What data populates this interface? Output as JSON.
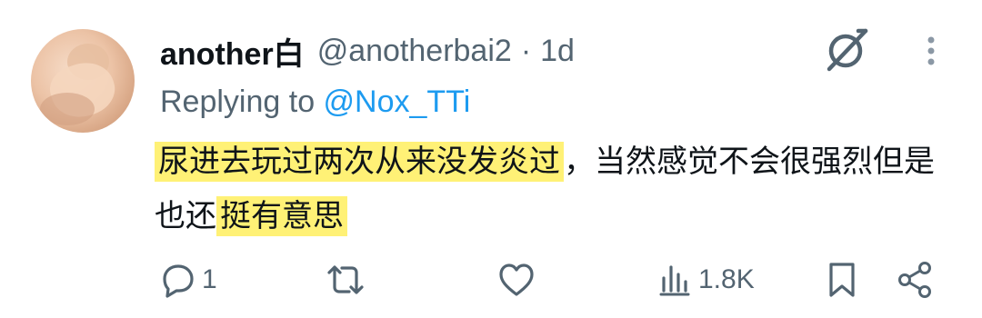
{
  "tweet": {
    "display_name": "another白",
    "handle": "@anotherbai2",
    "separator": "·",
    "time": "1d",
    "replying_prefix": "Replying to ",
    "replying_to": "@Nox_TTi",
    "text_part1": "尿进去玩过两次从来没发炎过",
    "text_part2": "，当然感觉不会很强烈但是也还",
    "text_part3": "挺有意思",
    "icons": {
      "avatar": "user-avatar",
      "grok": "grok-icon",
      "more": "more-dots-icon"
    }
  },
  "actions": {
    "reply_count": "1",
    "retweet_count": "",
    "like_count": "",
    "views_count": "1.8K",
    "icons": [
      "reply-icon",
      "retweet-icon",
      "like-icon",
      "views-icon",
      "bookmark-icon",
      "share-icon"
    ]
  },
  "colors": {
    "text_primary": "#0f1419",
    "text_secondary": "#536471",
    "link": "#1d9bf0",
    "highlight": "#fff176"
  }
}
